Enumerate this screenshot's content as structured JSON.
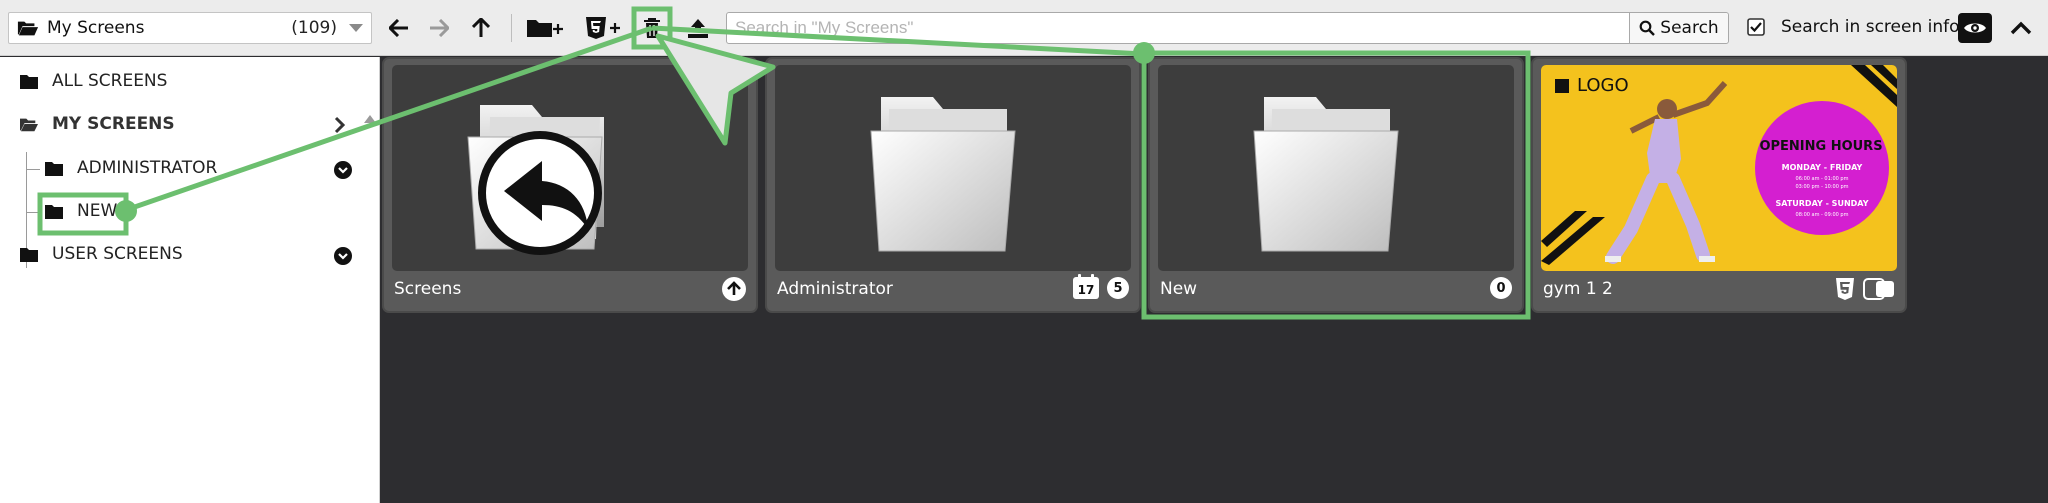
{
  "toolbar": {
    "folder_select": {
      "name": "My Screens",
      "count": "(109)"
    },
    "search": {
      "placeholder": "Search in \"My Screens\"",
      "button_label": "Search"
    },
    "search_info_label": "Search in screen info"
  },
  "sidebar": {
    "all_screens": "ALL SCREENS",
    "my_screens": "MY SCREENS",
    "administrator": "ADMINISTRATOR",
    "new": "NEW",
    "user_screens": "USER SCREENS"
  },
  "cards": [
    {
      "label": "Screens"
    },
    {
      "label": "Administrator",
      "badge_calendar": "17",
      "badge_count": "5"
    },
    {
      "label": "New",
      "badge_count": "0"
    },
    {
      "label": "gym 1 2"
    }
  ],
  "poster": {
    "logo": "LOGO",
    "title": "OPENING HOURS",
    "weekday_heading": "MONDAY - FRIDAY",
    "weekday_line1": "06:00 am - 01:00 pm",
    "weekday_line2": "03:00 pm - 10:00 pm",
    "weekend_heading": "SATURDAY - SUNDAY",
    "weekend_line1": "08:00 am - 09:00 pm"
  },
  "colors": {
    "highlight": "#6cbf6f",
    "canvas_bg": "#2d2d30",
    "card_bg": "#5a5a5a",
    "poster_bg": "#f4c21d",
    "poster_circle": "#d41fd0"
  }
}
